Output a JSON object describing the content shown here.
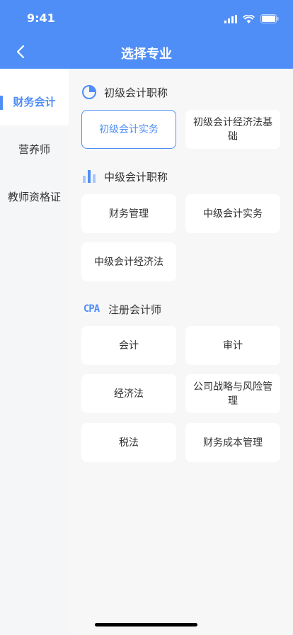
{
  "status": {
    "time": "9:41"
  },
  "nav": {
    "title": "选择专业"
  },
  "sidebar": {
    "items": [
      {
        "label": "财务会计",
        "active": true
      },
      {
        "label": "营养师",
        "active": false
      },
      {
        "label": "教师资格证",
        "active": false
      }
    ]
  },
  "sections": [
    {
      "title": "初级会计职称",
      "icon": "pie-chart-icon",
      "items": [
        "初级会计实务",
        "初级会计经济法基础"
      ]
    },
    {
      "title": "中级会计职称",
      "icon": "bar-chart-icon",
      "items": [
        "财务管理",
        "中级会计实务",
        "中级会计经济法"
      ]
    },
    {
      "title": "注册会计师",
      "icon": "cpa-icon",
      "items": [
        "会计",
        "审计",
        "经济法",
        "公司战略与风险管理",
        "税法",
        "财务成本管理"
      ]
    }
  ],
  "selected": "初级会计实务",
  "cpa_icon_text": "CPA",
  "colors": {
    "accent": "#4f8ef6",
    "background": "#f5f6f8"
  }
}
